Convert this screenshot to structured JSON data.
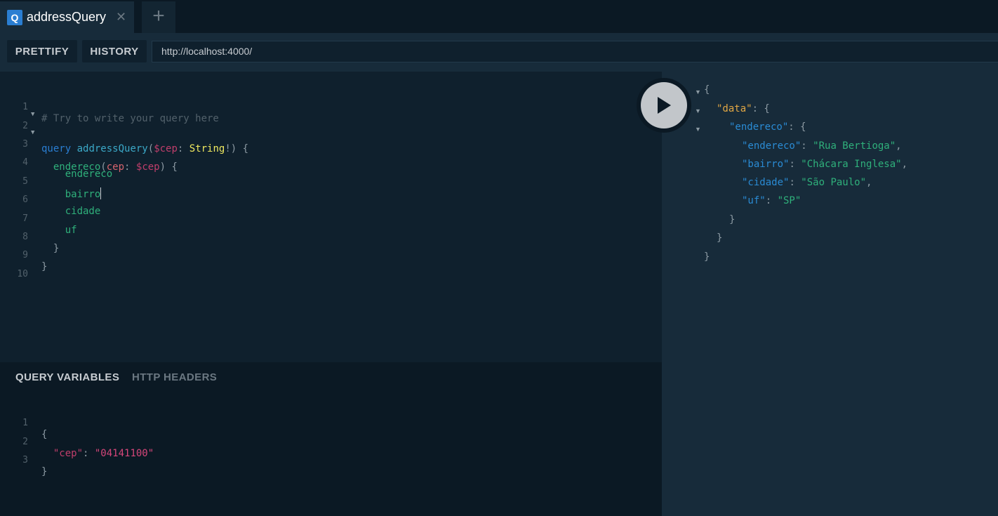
{
  "tabs": [
    {
      "badge": "Q",
      "title": "addressQuery",
      "close": "✕"
    }
  ],
  "new_tab_label": "+",
  "toolbar": {
    "prettify_label": "PRETTIFY",
    "history_label": "HISTORY",
    "endpoint_url": "http://localhost:4000/"
  },
  "query_editor": {
    "line_numbers": [
      "1",
      "2",
      "3",
      "4",
      "5",
      "6",
      "7",
      "8",
      "9",
      "10"
    ],
    "comment": "# Try to write your query here",
    "kw_query": "query",
    "op_name": "addressQuery",
    "var_cep": "$cep",
    "type_string": "String",
    "field_endereco": "endereco",
    "arg_cep": "cep",
    "arg_value": "$cep",
    "fields": [
      "endereco",
      "bairro",
      "cidade",
      "uf"
    ]
  },
  "variables_panel": {
    "tab_query_variables": "QUERY VARIABLES",
    "tab_http_headers": "HTTP HEADERS",
    "line_numbers": [
      "1",
      "2",
      "3"
    ],
    "key": "\"cep\"",
    "value": "\"04141100\""
  },
  "result": {
    "data_key": "\"data\"",
    "endereco_key": "\"endereco\"",
    "rows": [
      {
        "key": "\"endereco\"",
        "value": "\"Rua Bertioga\""
      },
      {
        "key": "\"bairro\"",
        "value": "\"Chácara Inglesa\""
      },
      {
        "key": "\"cidade\"",
        "value": "\"São Paulo\""
      },
      {
        "key": "\"uf\"",
        "value": "\"SP\""
      }
    ]
  },
  "colors": {
    "background": "#0f202d",
    "result_bg": "#172b3a",
    "accent": "#2a7ed2"
  }
}
